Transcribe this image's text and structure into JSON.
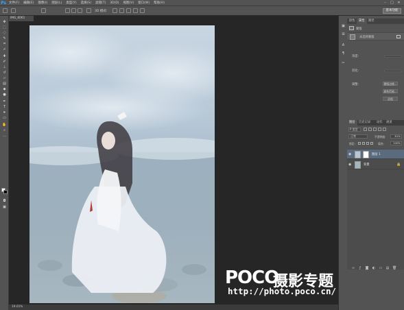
{
  "app": {
    "logo": "Ps"
  },
  "menubar": {
    "items": [
      "文件(F)",
      "编辑(E)",
      "图像(I)",
      "图层(L)",
      "类型(Y)",
      "选择(S)",
      "滤镜(T)",
      "3D(D)",
      "视图(V)",
      "窗口(W)",
      "帮助(H)"
    ],
    "minimize": "–",
    "maximize": "□",
    "close": "✕"
  },
  "optionsbar": {
    "mode_label": "3D 模式:",
    "workspace": "基本功能"
  },
  "document": {
    "tab_title": "IMG_6061",
    "zoom": "19.01%"
  },
  "adjustments_panel": {
    "tabs": [
      "颜色",
      "属性",
      "路径"
    ],
    "mask_label": "蒙版",
    "mask_name": "未选择蒙版",
    "density_label": "浓度:",
    "feather_label": "羽化:",
    "refine_label": "调整:",
    "btn_edge": "蒙版边缘...",
    "btn_color_range": "颜色范围...",
    "btn_invert": "反相"
  },
  "layers_panel": {
    "tabs": [
      "图层",
      "历史记录",
      "动作",
      "通道"
    ],
    "filter": "P 类型",
    "blend_mode": "正常",
    "opacity_label": "不透明度:",
    "opacity": "61%",
    "lock_label": "锁定:",
    "fill_label": "填充:",
    "fill": "100%",
    "layers": [
      {
        "name": "图层 1",
        "selected": true
      },
      {
        "name": "背景",
        "selected": false
      }
    ]
  },
  "watermark": {
    "brand": "POCO",
    "brand_cn": "摄影专题",
    "url": "http://photo.poco.cn/"
  },
  "colors": {
    "accent": "#31a8ff",
    "panel_bg": "#535353",
    "dark_bg": "#262626",
    "selected_layer": "#596b7d"
  }
}
